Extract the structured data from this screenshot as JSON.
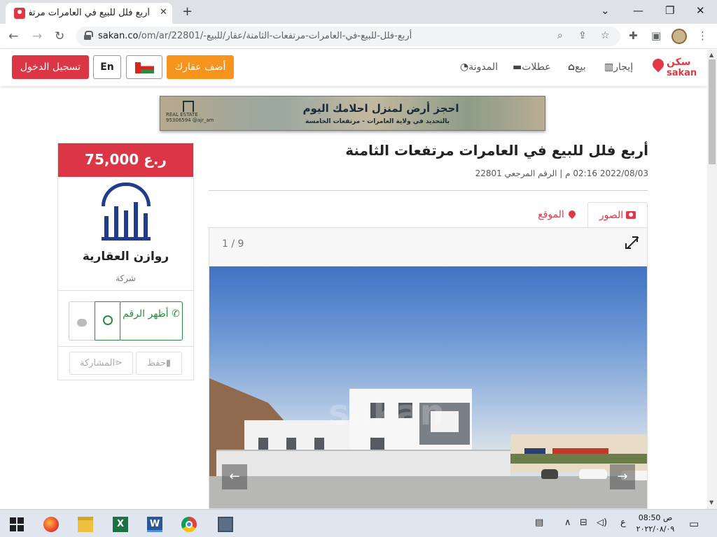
{
  "browser": {
    "tab_title": "أربع فلل للبيع في العامرات مرتفعات",
    "url_host": "sakan.co",
    "url_path": "/om/ar/22801/-أربع-فلل-للبيع-في-العامرات-مرتفعات-الثامنة/عقار/للبيع"
  },
  "site": {
    "logo_ar": "سكن",
    "logo_en": "sakan",
    "nav": [
      {
        "label": "إيجار",
        "icon": "building-icon"
      },
      {
        "label": "بيع",
        "icon": "home-icon"
      },
      {
        "label": "عطلات",
        "icon": "bed-icon"
      },
      {
        "label": "المدونة",
        "icon": "rss-icon"
      }
    ],
    "add_property": "أضف عقارك",
    "lang": "En",
    "login": "تسجيل الدخول"
  },
  "banner": {
    "headline": "احجز أرض لمنزل احلامك اليوم",
    "sub": "بالتحديد في ولاية العامرات - مرتفعات الخامسة",
    "contact": "95306594 @ajr_am",
    "brand": "REAL ESTATE"
  },
  "listing": {
    "title": "أربع فلل للبيع في العامرات مرتفعات الثامنة",
    "meta": "2022/08/03 02:16 م | الرقم المرجعي 22801",
    "tab_photos": "الصور",
    "tab_location": "الموقع",
    "photo_counter": "1 / 9",
    "watermark": "sakan"
  },
  "sidebar": {
    "price": "75,000 ر.ع",
    "agency_name": "روازن العقارية",
    "agency_type": "شركة",
    "show_number": "أظهر الرقم",
    "save": "حفظ",
    "share": "المشاركة"
  },
  "taskbar": {
    "time": "08:50 ص",
    "date": "٢٠٢٢/٠٨/٠٩",
    "lang": "ع"
  }
}
